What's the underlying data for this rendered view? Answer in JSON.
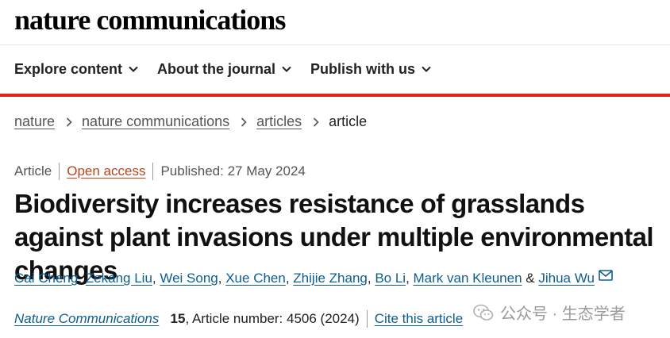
{
  "header": {
    "logo": "nature communications"
  },
  "nav": {
    "items": [
      {
        "label": "Explore content"
      },
      {
        "label": "About the journal"
      },
      {
        "label": "Publish with us"
      }
    ]
  },
  "breadcrumb": {
    "items": [
      "nature",
      "nature communications",
      "articles"
    ],
    "current": "article"
  },
  "article": {
    "type": "Article",
    "access": "Open access",
    "published": "Published: 27 May 2024",
    "title": "Biodiversity increases resistance of grasslands against plant invasions under multiple environmental changes",
    "authors": [
      "Cai Cheng",
      "Zekang Liu",
      "Wei Song",
      "Xue Chen",
      "Zhijie Zhang",
      "Bo Li",
      "Mark van Kleunen",
      "Jihua Wu"
    ],
    "journal": "Nature Communications",
    "volume": "15",
    "article_number": ", Article number: 4506 (2024)",
    "cite_label": "Cite this article"
  },
  "watermark": {
    "text": "公众号 · 生态学者"
  },
  "colors": {
    "accent_red": "#e2231a",
    "link_blue": "#0b5e8f",
    "open_access": "#b5451b"
  }
}
